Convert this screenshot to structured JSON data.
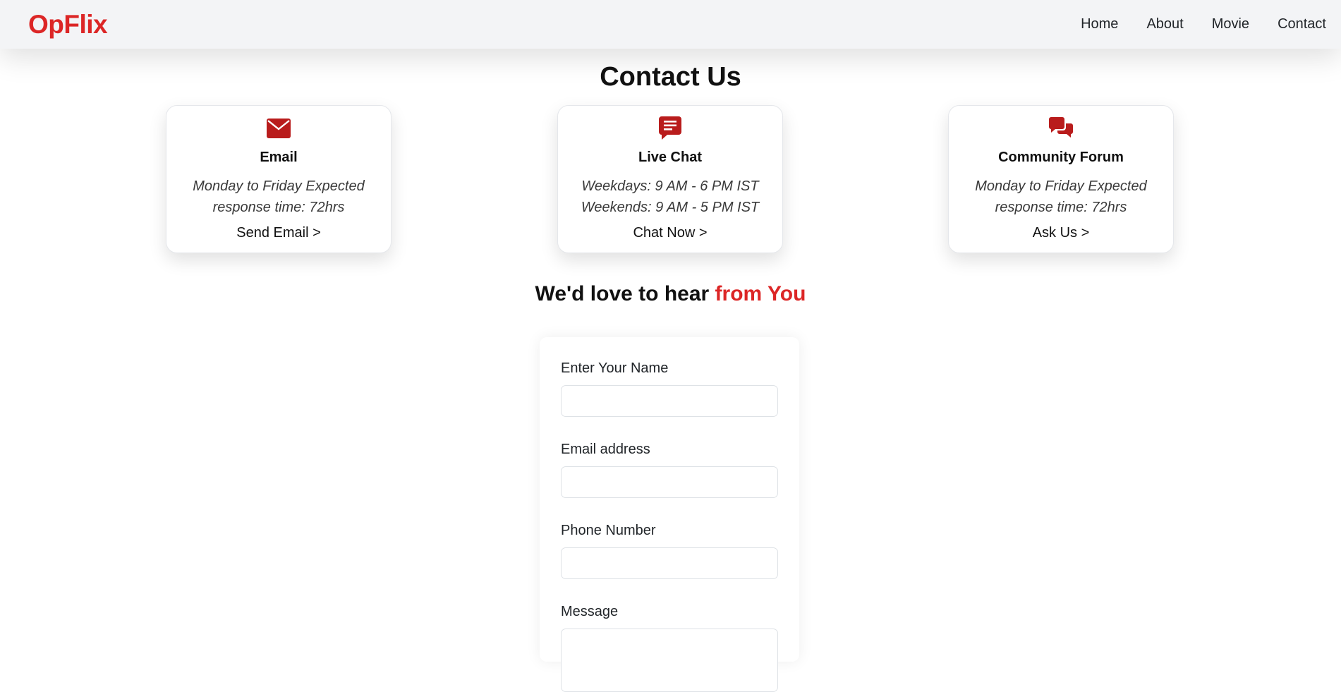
{
  "navbar": {
    "brand": "OpFlix",
    "links": [
      "Home",
      "About",
      "Movie",
      "Contact"
    ]
  },
  "page_title": "Contact Us",
  "cards": [
    {
      "icon": "envelope-icon",
      "title": "Email",
      "desc": "Monday to Friday Expected response time: 72hrs",
      "link": "Send Email >"
    },
    {
      "icon": "chat-icon",
      "title": "Live Chat",
      "desc": "Weekdays: 9 AM - 6 PM IST Weekends: 9 AM - 5 PM IST",
      "link": "Chat Now >"
    },
    {
      "icon": "comments-icon",
      "title": "Community Forum",
      "desc": "Monday to Friday Expected response time: 72hrs",
      "link": "Ask Us >"
    }
  ],
  "section_heading": {
    "prefix": "We'd love to hear ",
    "accent": "from You"
  },
  "form": {
    "name_label": "Enter Your Name",
    "name_value": "",
    "email_label": "Email address",
    "email_value": "",
    "phone_label": "Phone Number",
    "phone_value": "",
    "message_label": "Message",
    "message_value": ""
  },
  "colors": {
    "brand": "#dc2626",
    "icon": "#b91c1c",
    "navbar_bg": "#f3f4f6"
  }
}
